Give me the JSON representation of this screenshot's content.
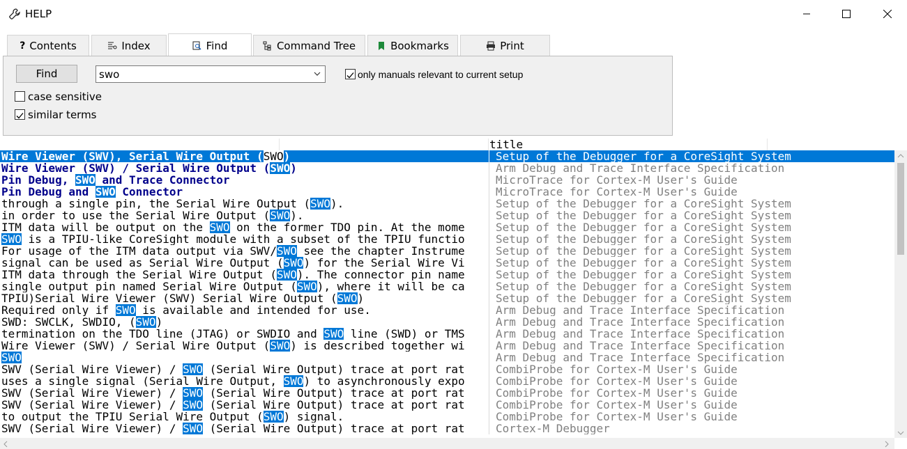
{
  "window": {
    "title": "HELP"
  },
  "tabs": [
    {
      "label": "Contents",
      "icon": "question-icon"
    },
    {
      "label": "Index",
      "icon": "index-icon"
    },
    {
      "label": "Find",
      "icon": "find-icon",
      "active": true
    },
    {
      "label": "Command Tree",
      "icon": "tree-icon"
    },
    {
      "label": "Bookmarks",
      "icon": "bookmark-icon"
    },
    {
      "label": "Print",
      "icon": "printer-icon"
    }
  ],
  "find": {
    "button_label": "Find",
    "query": "swo",
    "only_relevant_label": "only manuals relevant to current setup",
    "only_relevant_checked": true,
    "case_sensitive_label": "case sensitive",
    "case_sensitive_checked": false,
    "similar_terms_label": "similar terms",
    "similar_terms_checked": true
  },
  "results": {
    "columns": [
      "",
      "",
      "title",
      ""
    ],
    "rows": [
      {
        "text": [
          "Wire Viewer (SWV), Serial Wire Output (",
          "SWO",
          ")"
        ],
        "title": "Setup of the Debugger for a CoreSight System",
        "bold": true,
        "selected": true
      },
      {
        "text": [
          "Wire Viewer (SWV) / Serial Wire Output (",
          "SWO",
          ")"
        ],
        "title": "Arm Debug and Trace Interface Specification",
        "bold": true
      },
      {
        "text": [
          "Pin Debug, ",
          "SWO",
          " and Trace Connector"
        ],
        "title": "MicroTrace for Cortex-M User's Guide",
        "bold": true
      },
      {
        "text": [
          "Pin Debug and ",
          "SWO",
          " Connector"
        ],
        "title": "MicroTrace for Cortex-M User's Guide",
        "bold": true
      },
      {
        "text": [
          "through a single pin, the Serial Wire Output (",
          "SWO",
          ")."
        ],
        "title": "Setup of the Debugger for a CoreSight System"
      },
      {
        "text": [
          "in order to use the Serial Wire Output (",
          "SWO",
          ")."
        ],
        "title": "Setup of the Debugger for a CoreSight System"
      },
      {
        "text": [
          "ITM data will be output on the ",
          "SWO",
          " on the former TDO pin. At the mome"
        ],
        "title": "Setup of the Debugger for a CoreSight System"
      },
      {
        "text": [
          "",
          "SWO",
          " is a TPIU-like CoreSight module with a subset of the TPIU functio"
        ],
        "title": "Setup of the Debugger for a CoreSight System"
      },
      {
        "text": [
          "For usage of the ITM data output via SWV/",
          "SWO",
          " see the chapter Instrume"
        ],
        "title": "Setup of the Debugger for a CoreSight System"
      },
      {
        "text": [
          "signal can be used as Serial Wire Output (",
          "SWO",
          ") for the Serial Wire Vi"
        ],
        "title": "Setup of the Debugger for a CoreSight System"
      },
      {
        "text": [
          "ITM data through the Serial Wire Output (",
          "SWO",
          "). The connector pin name"
        ],
        "title": "Setup of the Debugger for a CoreSight System"
      },
      {
        "text": [
          "single output pin named Serial Wire Output (",
          "SWO",
          "), where it will be ca"
        ],
        "title": "Setup of the Debugger for a CoreSight System"
      },
      {
        "text": [
          "TPIU)Serial Wire Viewer (SWV) Serial Wire Output (",
          "SWO",
          ")"
        ],
        "title": "Setup of the Debugger for a CoreSight System"
      },
      {
        "text": [
          "Required only if ",
          "SWO",
          " is available and intended for use."
        ],
        "title": "Arm Debug and Trace Interface Specification"
      },
      {
        "text": [
          "SWD: SWCLK, SWDIO, (",
          "SWO",
          ")"
        ],
        "title": "Arm Debug and Trace Interface Specification"
      },
      {
        "text": [
          "termination on the TDO line (JTAG) or SWDIO and ",
          "SWO",
          " line (SWD) or TMS"
        ],
        "title": "Arm Debug and Trace Interface Specification"
      },
      {
        "text": [
          "Wire Viewer (SWV) / Serial Wire Output (",
          "SWO",
          ") is described together wi"
        ],
        "title": "Arm Debug and Trace Interface Specification"
      },
      {
        "text": [
          "",
          "SWO",
          ""
        ],
        "title": "Arm Debug and Trace Interface Specification"
      },
      {
        "text": [
          "SWV (Serial Wire Viewer) / ",
          "SWO",
          " (Serial Wire Output) trace at port rat"
        ],
        "title": "CombiProbe for Cortex-M User's Guide"
      },
      {
        "text": [
          "uses a single signal (Serial Wire Output, ",
          "SWO",
          ") to asynchronously expo"
        ],
        "title": "CombiProbe for Cortex-M User's Guide"
      },
      {
        "text": [
          "SWV (Serial Wire Viewer) / ",
          "SWO",
          " (Serial Wire Output) trace at port rat"
        ],
        "title": "CombiProbe for Cortex-M User's Guide"
      },
      {
        "text": [
          "SWV (Serial Wire Viewer) / ",
          "SWO",
          " (Serial Wire Output) trace at port rat"
        ],
        "title": "CombiProbe for Cortex-M User's Guide"
      },
      {
        "text": [
          "to output the TPIU Serial Wire Output (",
          "SWO",
          ") signal."
        ],
        "title": "CombiProbe for Cortex-M User's Guide"
      },
      {
        "text": [
          "SWV (Serial Wire Viewer) / ",
          "SWO",
          " (Serial Wire Output) trace at port rat"
        ],
        "title": "Cortex-M Debugger"
      }
    ]
  },
  "colors": {
    "selection": "#0078d7",
    "bold_text": "#00008b",
    "title_text": "#808080",
    "panel": "#f0f0f0"
  }
}
